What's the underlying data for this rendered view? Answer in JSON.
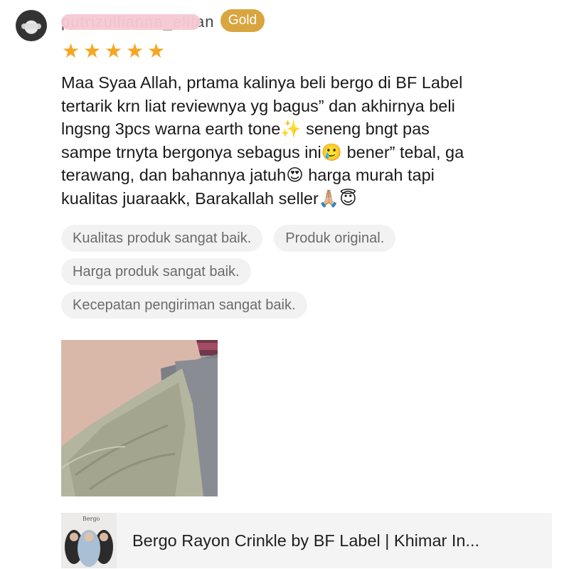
{
  "reviewer": {
    "name": "putrizullianna_elitan",
    "badge": "Gold",
    "rating": 5,
    "max_rating": 5
  },
  "review": {
    "lines": [
      "Maa Syaa Allah, prtama kalinya beli bergo di BF Label",
      "tertarik krn liat reviewnya yg bagus” dan akhirnya beli",
      "lngsng 3pcs warna earth tone✨  seneng bngt pas",
      "sampe trnyta bergonya sebagus ini🥲  bener” tebal, ga",
      "terawang, dan bahannya jatuh😍   harga murah tapi",
      "kualitas juaraakk, Barakallah seller🙏🏼😇"
    ]
  },
  "tags": [
    [
      "Kualitas produk sangat baik.",
      "Produk original."
    ],
    [
      "Harga produk sangat baik."
    ],
    [
      "Kecepatan pengiriman sangat baik."
    ]
  ],
  "product": {
    "thumb_brand": "Bergo",
    "title": "Bergo Rayon Crinkle by BF Label | Khimar In..."
  },
  "colors": {
    "badge": "#d9a53f",
    "star": "#f5a623",
    "tag_bg": "#f2f2f2",
    "tag_text": "#6b6b6b"
  },
  "icons": {
    "star": "star-icon",
    "avatar": "avatar"
  }
}
